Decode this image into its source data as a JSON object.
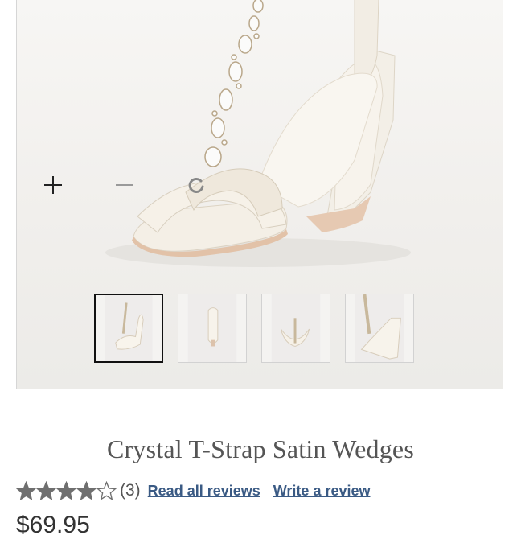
{
  "gallery": {
    "controls": {
      "zoom_in_icon": "plus-icon",
      "zoom_out_icon": "minus-icon",
      "loading_icon": "spinner-icon"
    },
    "thumbnails": [
      {
        "icon": "shoe-thumbnail-front",
        "selected": true
      },
      {
        "icon": "shoe-thumbnail-back",
        "selected": false
      },
      {
        "icon": "shoe-thumbnail-top",
        "selected": false
      },
      {
        "icon": "shoe-thumbnail-side",
        "selected": false
      }
    ]
  },
  "product": {
    "title": "Crystal T-Strap Satin Wedges",
    "rating": 4,
    "rating_max": 5,
    "review_count": "(3)",
    "read_reviews_label": "Read all reviews",
    "write_review_label": "Write a review",
    "price": "$69.95"
  },
  "colors": {
    "link": "#3a5a84",
    "star": "#6f6f6f",
    "title": "#555555"
  }
}
